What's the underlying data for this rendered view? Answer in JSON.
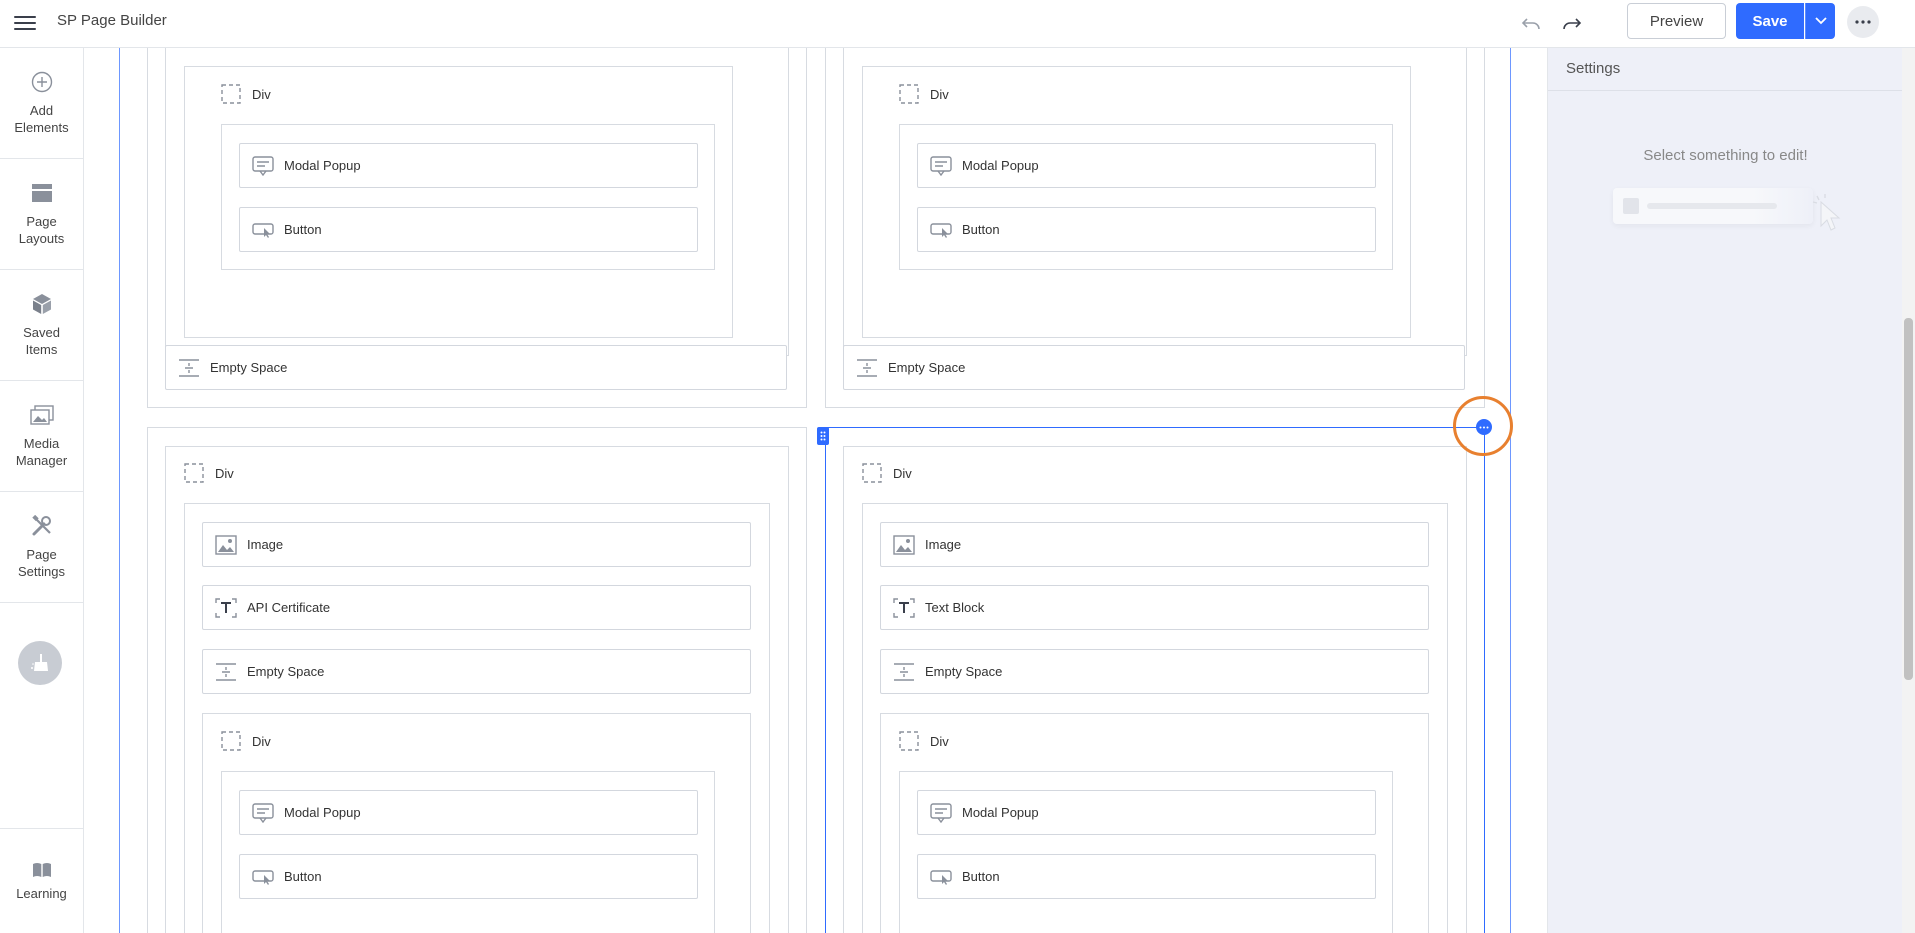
{
  "header": {
    "app_title": "SP Page Builder",
    "preview_label": "Preview",
    "save_label": "Save"
  },
  "sidebar": {
    "items": [
      {
        "label": "Add Elements",
        "icon": "plus-circle-icon"
      },
      {
        "label": "Page Layouts",
        "icon": "layout-icon"
      },
      {
        "label": "Saved Items",
        "icon": "box-icon"
      },
      {
        "label": "Media Manager",
        "icon": "images-icon"
      },
      {
        "label": "Page Settings",
        "icon": "tools-icon"
      }
    ],
    "learning_label": "Learning"
  },
  "canvas": {
    "top_row": {
      "left": {
        "div_label": "Div",
        "modal_label": "Modal Popup",
        "button_label": "Button",
        "empty_space_label": "Empty Space"
      },
      "right": {
        "div_label": "Div",
        "modal_label": "Modal Popup",
        "button_label": "Button",
        "empty_space_label": "Empty Space"
      }
    },
    "bottom_row": {
      "left": {
        "div_label": "Div",
        "image_label": "Image",
        "text_label": "API Certificate",
        "empty_space_label": "Empty Space",
        "inner_div_label": "Div",
        "modal_label": "Modal Popup",
        "button_label": "Button"
      },
      "right": {
        "div_label": "Div",
        "image_label": "Image",
        "text_label": "Text Block",
        "empty_space_label": "Empty Space",
        "inner_div_label": "Div",
        "modal_label": "Modal Popup",
        "button_label": "Button"
      }
    }
  },
  "settings": {
    "title": "Settings",
    "empty_message": "Select something to edit!"
  },
  "colors": {
    "accent": "#2f6bff",
    "highlight": "#e8802f",
    "panel_bg": "#eef0f8"
  }
}
